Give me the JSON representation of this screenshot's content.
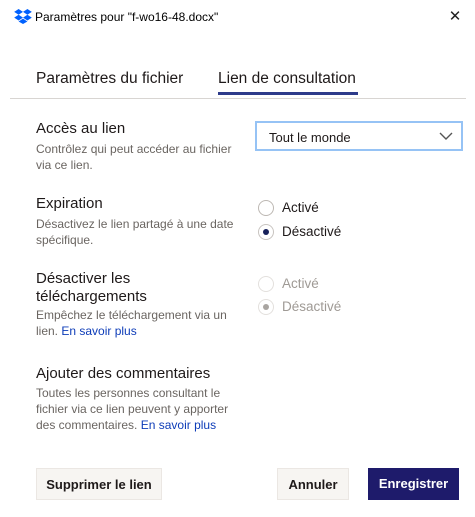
{
  "window": {
    "title": "Paramètres pour \"f-wo16-48.docx\"",
    "close_glyph": "✕",
    "app_icon": "dropbox-icon",
    "brand_color": "#0061fe"
  },
  "tabs": [
    {
      "label": "Paramètres du fichier",
      "active": false
    },
    {
      "label": "Lien de consultation",
      "active": true
    }
  ],
  "access": {
    "title": "Accès au lien",
    "description": "Contrôlez qui peut accéder au fichier via ce lien.",
    "select_value": "Tout le monde"
  },
  "expiration": {
    "title": "Expiration",
    "description": "Désactivez le lien partagé à une date spécifique.",
    "options": [
      {
        "label": "Activé",
        "checked": false
      },
      {
        "label": "Désactivé",
        "checked": true
      }
    ]
  },
  "downloads": {
    "title": "Désactiver les téléchargements",
    "description": "Empêchez le téléchargement via un lien.",
    "learn_more": "En savoir plus",
    "disabled": true,
    "options": [
      {
        "label": "Activé",
        "checked": false
      },
      {
        "label": "Désactivé",
        "checked": true
      }
    ]
  },
  "comments": {
    "title": "Ajouter des commentaires",
    "description": "Toutes les personnes consultant le fichier via ce lien peuvent y apporter des commentaires.",
    "learn_more": "En savoir plus"
  },
  "footer": {
    "delete_label": "Supprimer le lien",
    "cancel_label": "Annuler",
    "save_label": "Enregistrer"
  },
  "colors": {
    "accent": "#1e1b6b",
    "link": "#0d3cb8",
    "tab_underline": "#2d3b8a",
    "select_focus": "#96c3f5"
  }
}
